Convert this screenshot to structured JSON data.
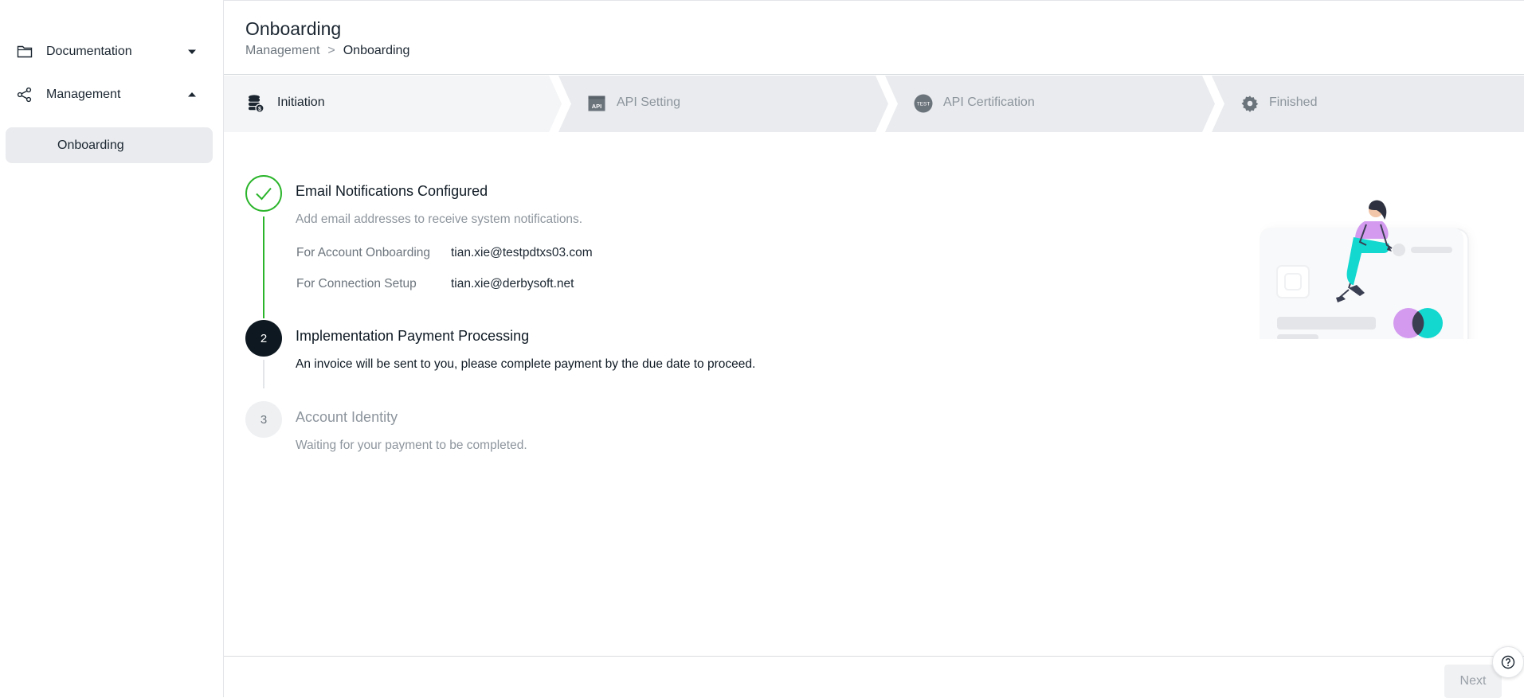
{
  "sidebar": {
    "items": [
      {
        "label": "Documentation",
        "icon": "folder-icon",
        "expanded": false
      },
      {
        "label": "Management",
        "icon": "share-icon",
        "expanded": true
      }
    ],
    "sub_items": [
      {
        "label": "Onboarding",
        "active": true
      }
    ]
  },
  "header": {
    "title": "Onboarding",
    "breadcrumb": [
      "Management",
      ">",
      "Onboarding"
    ]
  },
  "stepper": {
    "steps": [
      {
        "label": "Initiation",
        "icon": "coins-icon",
        "state": "active"
      },
      {
        "label": "API Setting",
        "icon": "api-icon",
        "state": "inactive"
      },
      {
        "label": "API Certification",
        "icon": "test-badge-icon",
        "icon_text": "TEST",
        "state": "inactive"
      },
      {
        "label": "Finished",
        "icon": "gear-icon",
        "state": "inactive"
      }
    ]
  },
  "checklist": {
    "items": [
      {
        "title": "Email Notifications Configured",
        "description": "Add email addresses to receive system notifications.",
        "status": "done",
        "details": [
          {
            "key": "For Account Onboarding",
            "value": "tian.xie@testpdtxs03.com"
          },
          {
            "key": "For Connection Setup",
            "value": "tian.xie@derbysoft.net"
          }
        ]
      },
      {
        "number": "2",
        "title": "Implementation Payment Processing",
        "description": "An invoice will be sent to you, please complete payment by the due date to proceed.",
        "status": "current"
      },
      {
        "number": "3",
        "title": "Account Identity",
        "description": "Waiting for your payment to be completed.",
        "status": "pending"
      }
    ]
  },
  "footer": {
    "next_label": "Next"
  },
  "colors": {
    "success": "#2bb52b",
    "current": "#0d1820",
    "accent_teal": "#12d8d0",
    "accent_purple": "#d39af0"
  }
}
